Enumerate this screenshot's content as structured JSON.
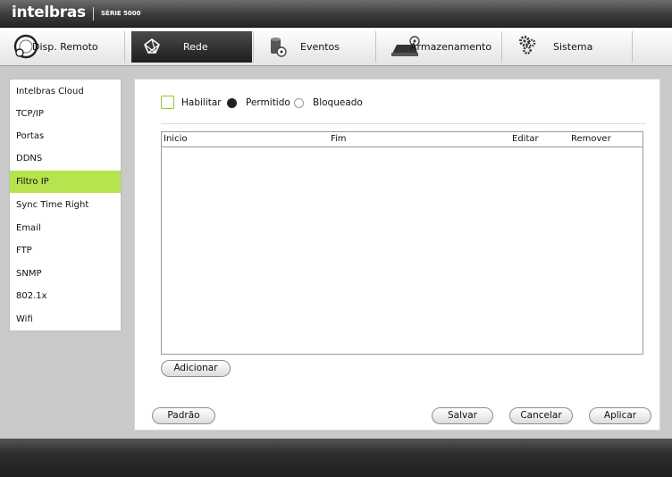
{
  "brand": {
    "logo": "intelbras",
    "series": "SÉRIE 5000"
  },
  "menu": {
    "items": [
      {
        "label": "Disp. Remoto",
        "icon": "remote-device-icon"
      },
      {
        "label": "Rede",
        "icon": "network-icon",
        "active": true
      },
      {
        "label": "Eventos",
        "icon": "events-icon"
      },
      {
        "label": "Armazenamento",
        "icon": "storage-icon"
      },
      {
        "label": "Sistema",
        "icon": "gears-icon"
      }
    ]
  },
  "sidebar": {
    "items": [
      {
        "label": "Intelbras Cloud"
      },
      {
        "label": "TCP/IP"
      },
      {
        "label": "Portas"
      },
      {
        "label": "DDNS"
      },
      {
        "label": "Filtro IP",
        "active": true
      },
      {
        "label": "Sync Time Right"
      },
      {
        "label": "Email"
      },
      {
        "label": "FTP"
      },
      {
        "label": "SNMP"
      },
      {
        "label": "802.1x"
      },
      {
        "label": "Wifi"
      }
    ]
  },
  "filter": {
    "enable_label": "Habilitar",
    "enabled": false,
    "mode": "Permitido",
    "allow_label": "Permitido",
    "block_label": "Bloqueado"
  },
  "table": {
    "columns": [
      "Inicio",
      "Fim",
      "Editar",
      "Remover"
    ],
    "rows": []
  },
  "buttons": {
    "add": "Adicionar",
    "default": "Padrão",
    "save": "Salvar",
    "cancel": "Cancelar",
    "apply": "Aplicar"
  },
  "colors": {
    "accent": "#b6e34e",
    "active_menu": "#2a2a2a"
  }
}
